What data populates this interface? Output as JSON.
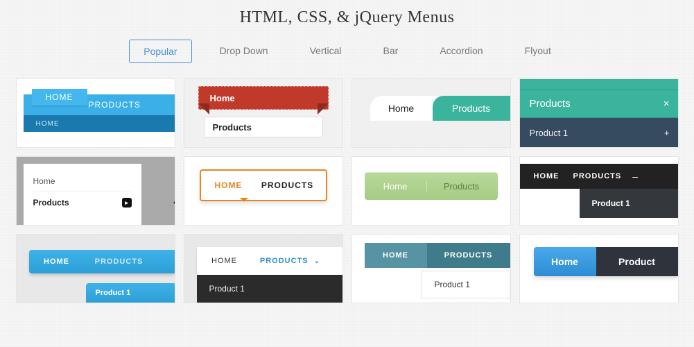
{
  "title": "HTML, CSS, & jQuery Menus",
  "tabs": [
    "Popular",
    "Drop Down",
    "Vertical",
    "Bar",
    "Accordion",
    "Flyout"
  ],
  "activeTab": 0,
  "cards": {
    "c1": {
      "home": "HOME",
      "products": "PRODUCTS",
      "shadow": "HOME"
    },
    "c2": {
      "home": "Home",
      "products": "Products"
    },
    "c3": {
      "home": "Home",
      "products": "Products"
    },
    "c4": {
      "top": "",
      "products": "Products",
      "close": "×",
      "item": "Product 1",
      "plus": "+"
    },
    "c5": {
      "home": "Home",
      "products": "Products",
      "chip": "▸"
    },
    "c6": {
      "home": "HOME",
      "products": "PRODUCTS"
    },
    "c7": {
      "home": "Home",
      "products": "Products"
    },
    "c8": {
      "home": "HOME",
      "products": "PRODUCTS",
      "minus": "–",
      "item": "Product 1"
    },
    "c9": {
      "home": "HOME",
      "products": "PRODUCTS",
      "item": "Product 1"
    },
    "c10": {
      "home": "HOME",
      "products": "PRODUCTS",
      "chev": "⌄",
      "item": "Product 1"
    },
    "c11": {
      "home": "HOME",
      "products": "PRODUCTS",
      "item": "Product 1"
    },
    "c12": {
      "home": "Home",
      "products": "Product"
    }
  }
}
